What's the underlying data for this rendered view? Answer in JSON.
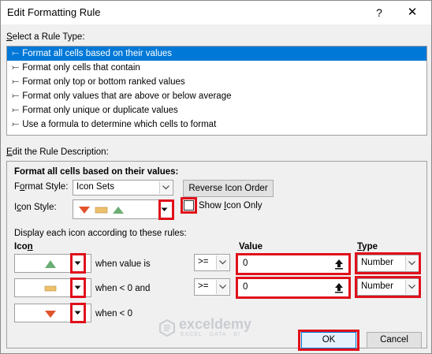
{
  "dialog": {
    "title": "Edit Formatting Rule",
    "help_glyph": "?",
    "close_glyph": "✕"
  },
  "rule_type": {
    "label_u": "S",
    "label_rest": "elect a Rule Type:",
    "items": [
      {
        "label": "Format all cells based on their values",
        "selected": true
      },
      {
        "label": "Format only cells that contain",
        "selected": false
      },
      {
        "label": "Format only top or bottom ranked values",
        "selected": false
      },
      {
        "label": "Format only values that are above or below average",
        "selected": false
      },
      {
        "label": "Format only unique or duplicate values",
        "selected": false
      },
      {
        "label": "Use a formula to determine which cells to format",
        "selected": false
      }
    ],
    "bullet": "⤚"
  },
  "description": {
    "label_u": "E",
    "label_rest": "dit the Rule Description:",
    "heading": "Format all cells based on their values:",
    "format_style_label_pre": "F",
    "format_style_label_u": "o",
    "format_style_label_post": "rmat Style:",
    "format_style_value": "Icon Sets",
    "reverse_button": "Reverse Icon Order",
    "reverse_u": "d",
    "icon_style_label_pre": "I",
    "icon_style_label_u": "c",
    "icon_style_label_post": "on Style:",
    "show_icon_only_pre": "Show ",
    "show_icon_only_u": "I",
    "show_icon_only_post": "con Only",
    "show_icon_only_checked": false,
    "rules_caption": "Display each icon according to these rules:",
    "col_icon_pre": "Ico",
    "col_icon_u": "n",
    "col_value": "Value",
    "col_type_u": "T",
    "col_type_rest": "ype"
  },
  "rows": [
    {
      "icon": "up-triangle-icon",
      "condition": "when value is",
      "operator": ">=",
      "value": "0",
      "type": "Number"
    },
    {
      "icon": "dash-icon",
      "condition": "when < 0 and",
      "operator": ">=",
      "value": "0",
      "type": "Number"
    },
    {
      "icon": "down-triangle-icon",
      "condition": "when < 0"
    }
  ],
  "colors": {
    "green": "#6cae75",
    "yellow": "#efc16d",
    "red": "#e0532b",
    "highlight": "#e0101a",
    "selection": "#0078d7"
  },
  "watermark": {
    "name": "exceldemy",
    "tagline": "EXCEL · DATA · BI"
  },
  "buttons": {
    "ok": "OK",
    "cancel": "Cancel"
  }
}
